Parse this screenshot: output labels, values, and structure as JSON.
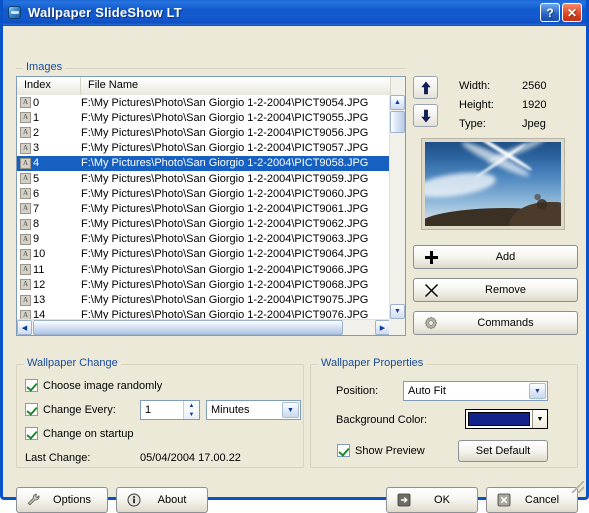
{
  "window": {
    "title": "Wallpaper SlideShow LT",
    "icon": "app-globe-icon",
    "help_label": "?",
    "close_label": "✕",
    "accent_title_bar": "#1059cd",
    "dialog_background": "#ece9d8"
  },
  "images_group": {
    "title": "Images",
    "columns": [
      "Index",
      "File Name"
    ],
    "selected_index": 4,
    "rows": [
      {
        "index": "0",
        "file": "F:\\My Pictures\\Photo\\San Giorgio 1-2-2004\\PICT9054.JPG"
      },
      {
        "index": "1",
        "file": "F:\\My Pictures\\Photo\\San Giorgio 1-2-2004\\PICT9055.JPG"
      },
      {
        "index": "2",
        "file": "F:\\My Pictures\\Photo\\San Giorgio 1-2-2004\\PICT9056.JPG"
      },
      {
        "index": "3",
        "file": "F:\\My Pictures\\Photo\\San Giorgio 1-2-2004\\PICT9057.JPG"
      },
      {
        "index": "4",
        "file": "F:\\My Pictures\\Photo\\San Giorgio 1-2-2004\\PICT9058.JPG"
      },
      {
        "index": "5",
        "file": "F:\\My Pictures\\Photo\\San Giorgio 1-2-2004\\PICT9059.JPG"
      },
      {
        "index": "6",
        "file": "F:\\My Pictures\\Photo\\San Giorgio 1-2-2004\\PICT9060.JPG"
      },
      {
        "index": "7",
        "file": "F:\\My Pictures\\Photo\\San Giorgio 1-2-2004\\PICT9061.JPG"
      },
      {
        "index": "8",
        "file": "F:\\My Pictures\\Photo\\San Giorgio 1-2-2004\\PICT9062.JPG"
      },
      {
        "index": "9",
        "file": "F:\\My Pictures\\Photo\\San Giorgio 1-2-2004\\PICT9063.JPG"
      },
      {
        "index": "10",
        "file": "F:\\My Pictures\\Photo\\San Giorgio 1-2-2004\\PICT9064.JPG"
      },
      {
        "index": "11",
        "file": "F:\\My Pictures\\Photo\\San Giorgio 1-2-2004\\PICT9066.JPG"
      },
      {
        "index": "12",
        "file": "F:\\My Pictures\\Photo\\San Giorgio 1-2-2004\\PICT9068.JPG"
      },
      {
        "index": "13",
        "file": "F:\\My Pictures\\Photo\\San Giorgio 1-2-2004\\PICT9075.JPG"
      },
      {
        "index": "14",
        "file": "F:\\My Pictures\\Photo\\San Giorgio 1-2-2004\\PICT9076.JPG"
      }
    ],
    "row_icon": "image-file-icon"
  },
  "image_info": {
    "width_label": "Width:",
    "width_value": "2560",
    "height_label": "Height:",
    "height_value": "1920",
    "type_label": "Type:",
    "type_value": "Jpeg"
  },
  "move_buttons": {
    "up": "move-up-arrow-icon",
    "down": "move-down-arrow-icon"
  },
  "image_actions": {
    "add_label": "Add",
    "add_icon": "plus-icon",
    "remove_label": "Remove",
    "remove_icon": "cross-icon",
    "commands_label": "Commands",
    "commands_icon": "gear-icon"
  },
  "wallpaper_change": {
    "title": "Wallpaper Change",
    "choose_random_label": "Choose image randomly",
    "choose_random_checked": true,
    "change_every_label": "Change Every:",
    "change_every_checked": true,
    "interval_value": "1",
    "interval_unit": "Minutes",
    "change_on_startup_label": "Change on startup",
    "change_on_startup_checked": true,
    "last_change_label": "Last Change:",
    "last_change_value": "05/04/2004 17.00.22"
  },
  "wallpaper_properties": {
    "title": "Wallpaper Properties",
    "position_label": "Position:",
    "position_value": "Auto Fit",
    "background_color_label": "Background Color:",
    "background_color_value": "#13238c",
    "show_preview_label": "Show Preview",
    "show_preview_checked": true,
    "set_default_label": "Set Default"
  },
  "footer": {
    "options_label": "Options",
    "options_icon": "wrench-icon",
    "about_label": "About",
    "about_icon": "info-icon",
    "ok_label": "OK",
    "ok_icon": "enter-arrow-icon",
    "cancel_label": "Cancel",
    "cancel_icon": "cancel-x-icon"
  }
}
